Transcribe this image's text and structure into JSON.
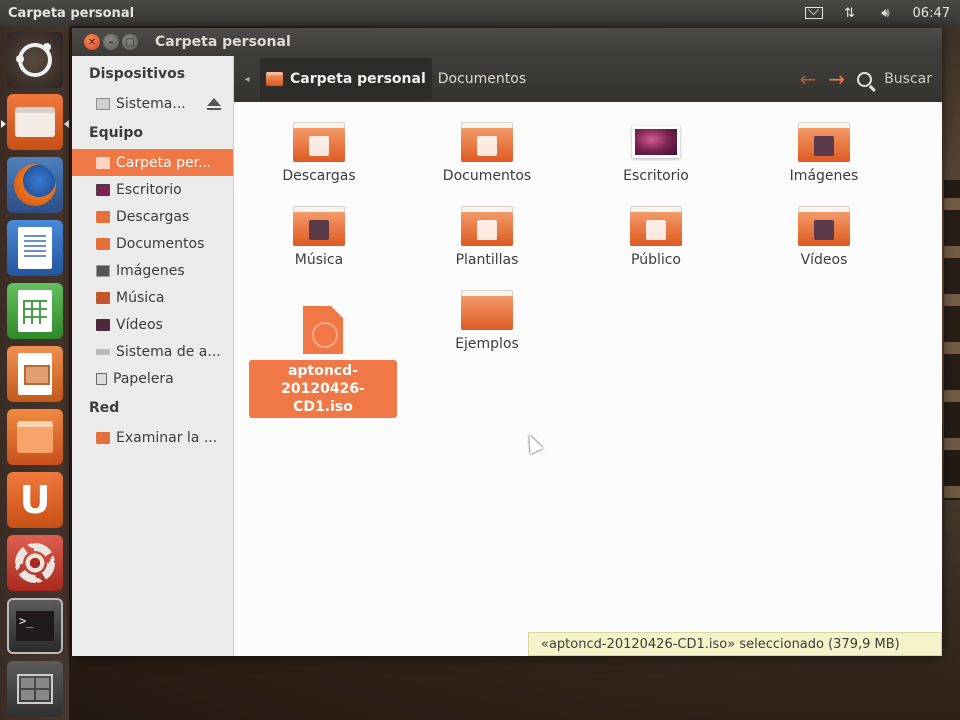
{
  "top_panel": {
    "title": "Carpeta personal",
    "clock": "06:47",
    "icons": [
      "mail-icon",
      "network-icon",
      "volume-icon"
    ]
  },
  "launcher": {
    "items": [
      "dash-home",
      "files",
      "firefox",
      "libreoffice-writer",
      "libreoffice-calc",
      "libreoffice-impress",
      "ubuntu-software-center",
      "ubuntu-one",
      "system-settings",
      "terminal",
      "workspace-switcher"
    ]
  },
  "window": {
    "title": "Carpeta personal"
  },
  "sidebar": {
    "sections": [
      {
        "heading": "Dispositivos",
        "items": [
          {
            "label": "Sistema...",
            "icon": "drive-icon",
            "ejectable": true
          }
        ]
      },
      {
        "heading": "Equipo",
        "items": [
          {
            "label": "Carpeta per...",
            "icon": "home-folder-icon",
            "active": true
          },
          {
            "label": "Escritorio",
            "icon": "desktop-icon"
          },
          {
            "label": "Descargas",
            "icon": "downloads-icon"
          },
          {
            "label": "Documentos",
            "icon": "documents-icon"
          },
          {
            "label": "Imágenes",
            "icon": "pictures-icon"
          },
          {
            "label": "Música",
            "icon": "music-icon"
          },
          {
            "label": "Vídeos",
            "icon": "videos-icon"
          },
          {
            "label": "Sistema de a...",
            "icon": "filesystem-icon"
          },
          {
            "label": "Papelera",
            "icon": "trash-icon"
          }
        ]
      },
      {
        "heading": "Red",
        "items": [
          {
            "label": "Examinar la ...",
            "icon": "network-browse-icon"
          }
        ]
      }
    ]
  },
  "toolbar": {
    "breadcrumbs": [
      "Carpeta personal",
      "Documentos"
    ],
    "search_label": "Buscar"
  },
  "files": [
    {
      "name": "Descargas",
      "icon": "downloads-folder-icon"
    },
    {
      "name": "Documentos",
      "icon": "documents-folder-icon"
    },
    {
      "name": "Escritorio",
      "icon": "desktop-wallpaper-icon"
    },
    {
      "name": "Imágenes",
      "icon": "pictures-folder-icon"
    },
    {
      "name": "Música",
      "icon": "music-folder-icon"
    },
    {
      "name": "Plantillas",
      "icon": "templates-folder-icon"
    },
    {
      "name": "Público",
      "icon": "public-folder-icon"
    },
    {
      "name": "Vídeos",
      "icon": "videos-folder-icon"
    },
    {
      "name": "aptoncd-20120426-CD1.iso",
      "icon": "iso-file-icon",
      "selected": true,
      "label_line1": "aptoncd-20120426-",
      "label_line2": "CD1.iso"
    },
    {
      "name": "Ejemplos",
      "icon": "examples-folder-link-icon"
    }
  ],
  "status": "«aptoncd-20120426-CD1.iso» seleccionado (379,9 MB)",
  "colors": {
    "accent": "#f07746",
    "panel": "#3c3a36",
    "status_bg": "#f4f3c9"
  }
}
